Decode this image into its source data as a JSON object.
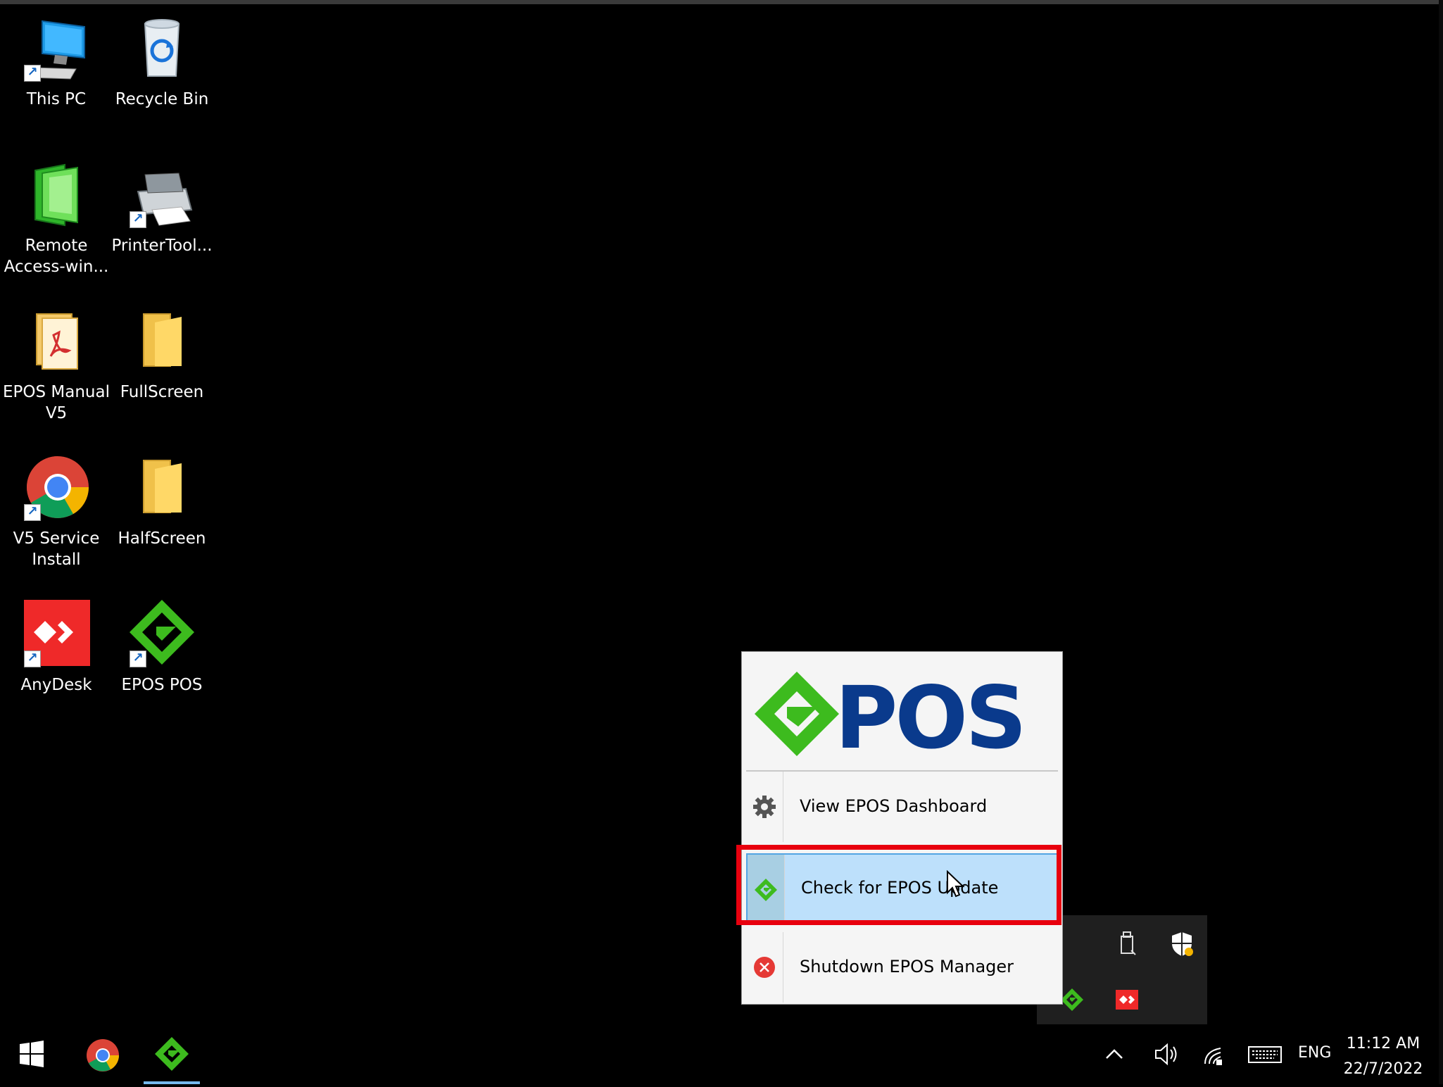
{
  "desktop": {
    "icons": [
      {
        "label": "This PC"
      },
      {
        "label": "Recycle Bin"
      },
      {
        "label": "Remote Access-win..."
      },
      {
        "label": "PrinterTool..."
      },
      {
        "label": "EPOS Manual V5"
      },
      {
        "label": "FullScreen"
      },
      {
        "label": "V5 Service Install"
      },
      {
        "label": "HalfScreen"
      },
      {
        "label": "AnyDesk"
      },
      {
        "label": "EPOS POS"
      }
    ]
  },
  "epos_menu": {
    "logo_text": "POS",
    "items": [
      {
        "label": "View EPOS Dashboard",
        "icon": "gear-icon"
      },
      {
        "label": "Check for EPOS Update",
        "icon": "epos-logo-icon"
      },
      {
        "label": "Shutdown EPOS Manager",
        "icon": "close-circle-icon"
      }
    ],
    "selected_index": 1
  },
  "taskbar": {
    "language": "ENG",
    "time": "11:12 AM",
    "date": "22/7/2022"
  },
  "colors": {
    "epos_green": "#3dbb1e",
    "epos_blue": "#0a3a8c",
    "highlight_red": "#e8000e",
    "selection_blue": "#bde0fb",
    "anydesk_red": "#ef2929"
  }
}
